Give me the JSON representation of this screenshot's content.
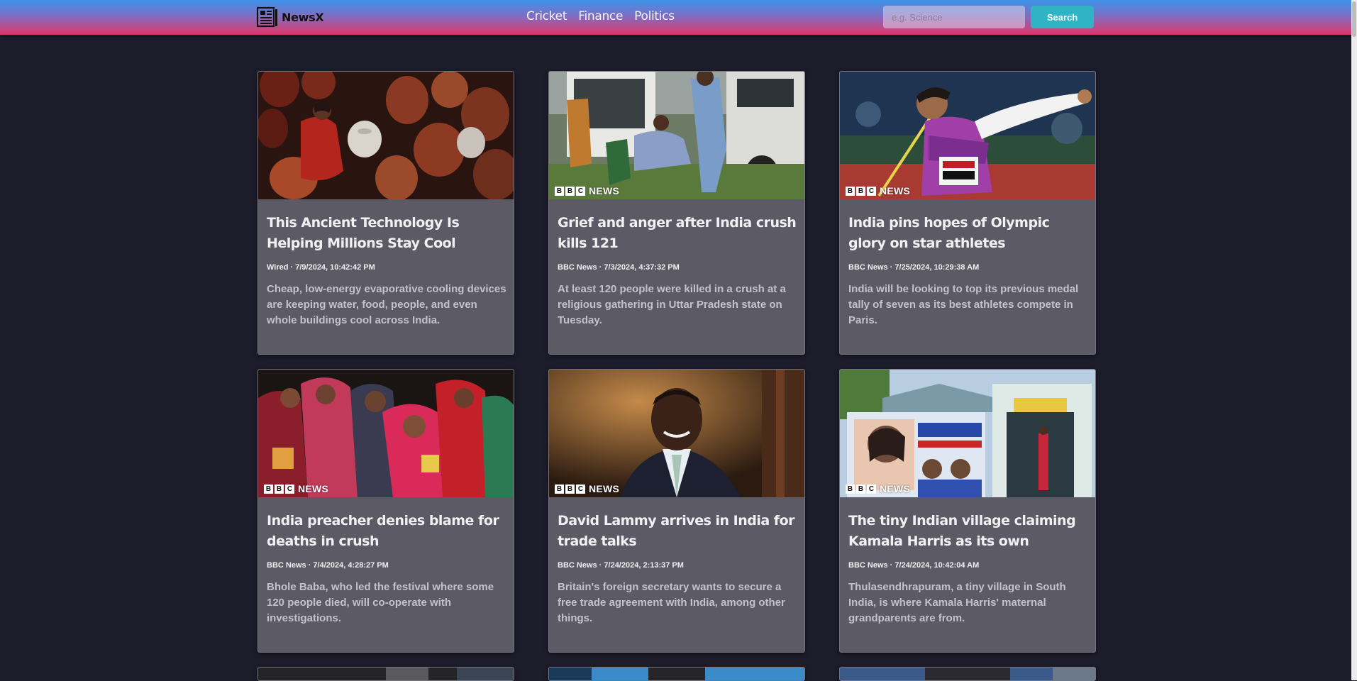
{
  "header": {
    "brand": "NewsX",
    "nav": [
      "Cricket",
      "Finance",
      "Politics"
    ],
    "search_placeholder": "e.g. Science",
    "search_button": "Search"
  },
  "articles": [
    {
      "title": "This Ancient Technology Is Helping Millions Stay Cool",
      "meta": "Wired · 7/9/2024, 10:42:42 PM",
      "description": "Cheap, low-energy evaporative cooling devices are keeping water, food, people, and even whole buildings cool across India.",
      "image": "clay-pots-photo"
    },
    {
      "title": "Grief and anger after India crush kills 121",
      "meta": "BBC News · 7/3/2024, 4:37:32 PM",
      "description": "At least 120 people were killed in a crush at a religious gathering in Uttar Pradesh state on Tuesday.",
      "image": "crush-grief-photo",
      "watermark": "NEWS"
    },
    {
      "title": "India pins hopes of Olympic glory on star athletes",
      "meta": "BBC News · 7/25/2024, 10:29:38 AM",
      "description": "India will be looking to top its previous medal tally of seven as its best athletes compete in Paris.",
      "image": "javelin-athlete-photo",
      "watermark": "NEWS"
    },
    {
      "title": "India preacher denies blame for deaths in crush",
      "meta": "BBC News · 7/4/2024, 4:28:27 PM",
      "description": "Bhole Baba, who led the festival where some 120 people died, will co-operate with investigations.",
      "image": "mourning-women-photo",
      "watermark": "NEWS"
    },
    {
      "title": "David Lammy arrives in India for trade talks",
      "meta": "BBC News · 7/24/2024, 2:13:37 PM",
      "description": "Britain's foreign secretary wants to secure a free trade agreement with India, among other things.",
      "image": "suited-man-portrait-photo",
      "watermark": "NEWS"
    },
    {
      "title": "The tiny Indian village claiming Kamala Harris as its own",
      "meta": "BBC News · 7/24/2024, 10:42:04 AM",
      "description": "Thulasendhrapuram, a tiny village in South India, is where Kamala Harris' maternal grandparents are from.",
      "image": "village-banner-photo",
      "watermark": "NEWS"
    }
  ],
  "colors": {
    "page_bg": "#1d1c2b",
    "card_bg": "#5b5a65",
    "search_button": "#31b3c6",
    "navbar_gradient": [
      "#3d93e9",
      "#d9336a"
    ]
  }
}
